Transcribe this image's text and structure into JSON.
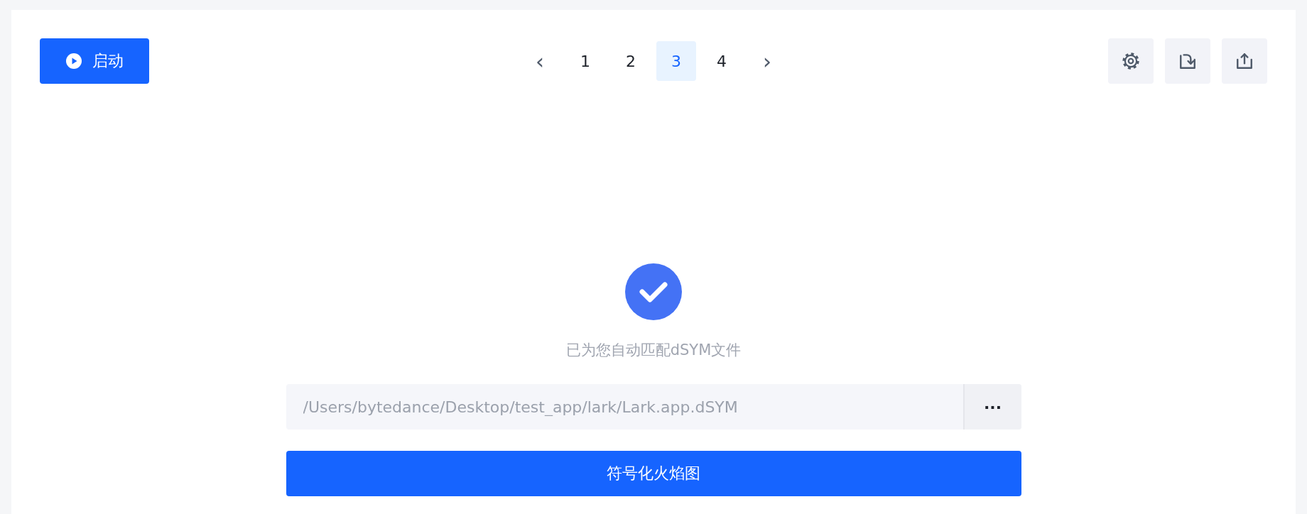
{
  "start_button": {
    "label": "启动"
  },
  "pagination": {
    "prev": "‹",
    "next": "›",
    "pages": [
      {
        "label": "1",
        "selected": false
      },
      {
        "label": "2",
        "selected": false
      },
      {
        "label": "3",
        "selected": true
      },
      {
        "label": "4",
        "selected": false
      }
    ]
  },
  "status": {
    "message": "已为您自动匹配dSYM文件"
  },
  "path_field": {
    "placeholder": "/Users/bytedance/Desktop/test_app/lark/Lark.app.dSYM",
    "browse": "···"
  },
  "submit_button": {
    "label": "符号化火焰图"
  }
}
